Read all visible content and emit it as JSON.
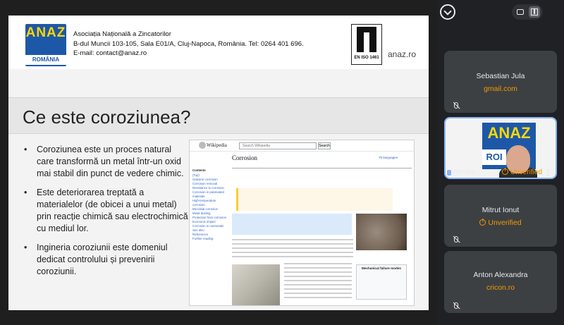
{
  "slide": {
    "org_name": "Asociația Națională a Zincatorilor",
    "address": "B-dul Muncii 103-105, Sala E01/A, Cluj-Napoca, România. Tel: 0264 401 696.",
    "email": "E-mail: contact@anaz.ro",
    "logo_word": "ANAZ",
    "logo_country": "ROMÂNIA",
    "iso_label": "EN ISO 1461",
    "site": "anaz.ro",
    "title": "Ce este coroziunea?",
    "bullets": [
      "Coroziunea este un proces natural care transformă un metal într-un oxid mai stabil din punct de vedere chimic.",
      "Este deteriorarea treptată a materialelor (de obicei a unui metal) prin reacție chimică sau electrochimică cu mediul lor.",
      "Ingineria coroziunii este domeniul dedicat controlului și prevenirii coroziunii."
    ]
  },
  "wiki": {
    "logo": "Wikipedia",
    "search_placeholder": "Search Wikipedia",
    "search_button": "Search",
    "article_title": "Corrosion",
    "languages": "76 languages",
    "sidebar_head": "Contents",
    "sidebar_items": [
      "(Top)",
      "Galvanic corrosion",
      "Corrosion removal",
      "Resistance to corrosion",
      "Corrosion in passivated materials",
      "High-temperature corrosion",
      "Microbial corrosion",
      "Metal dusting",
      "Protection from corrosion",
      "Economic impact",
      "Corrosion in nonmetals",
      "See also",
      "References",
      "Further reading"
    ],
    "infobox_title": "Mechanical failure modes"
  },
  "panel": {
    "participants": [
      {
        "name": "Sebastian Jula",
        "sub": "gmail.com"
      },
      {
        "name": "Vermes...",
        "sub": "Unverified"
      },
      {
        "name": "Mitrut Ionut",
        "sub": "Unverified"
      },
      {
        "name": "Anton Alexandra",
        "sub": "cricon.ro"
      }
    ],
    "mini_slide_word": "ANAZ",
    "mini_slide_ro": "ROI"
  },
  "colors": {
    "accent": "#8ab4f8",
    "warning": "#f29900",
    "brand_blue": "#1d58a8",
    "brand_yellow": "#ffd700"
  }
}
